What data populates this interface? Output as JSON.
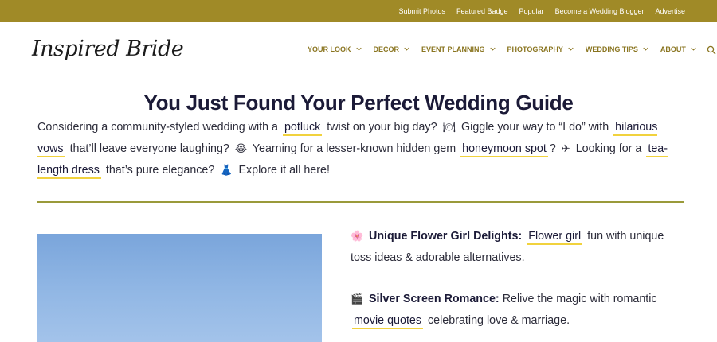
{
  "topbar": {
    "links": [
      "Submit Photos",
      "Featured Badge",
      "Popular",
      "Become a Wedding Blogger",
      "Advertise"
    ]
  },
  "logo": {
    "text": "Inspired Bride"
  },
  "nav": {
    "items": [
      "YOUR LOOK",
      "DECOR",
      "EVENT PLANNING",
      "PHOTOGRAPHY",
      "WEDDING TIPS",
      "ABOUT"
    ],
    "search_icon": "search-icon"
  },
  "page_title": "You Just Found Your Perfect Wedding Guide",
  "intro": {
    "t1": "Considering a community-styled wedding with a",
    "link1": "potluck",
    "t2": "twist on your big day?",
    "e1": "🍽",
    "t3": "Giggle your way to “I do” with",
    "link2": "hilarious vows",
    "t4": "that’ll leave everyone laughing?",
    "e2": "😂",
    "t5": "Yearning for a lesser-known hidden gem",
    "link3": "honeymoon spot",
    "t6": "?",
    "e3": "✈",
    "t7": "Looking for a",
    "link4": "tea-length dress",
    "t8": "that’s pure elegance?",
    "e4": "👗",
    "t9": "Explore it all here!"
  },
  "features": [
    {
      "icon": "🌸",
      "title": "Unique Flower Girl Delights:",
      "link": "Flower girl",
      "text": "fun with unique toss ideas & adorable alternatives."
    },
    {
      "icon": "🎬",
      "title": "Silver Screen Romance:",
      "pre": "Relive the magic with romantic",
      "link": "movie quotes",
      "text": "celebrating love & marriage."
    }
  ],
  "colors": {
    "topbar": "#a08a27",
    "nav": "#8a7520",
    "highlight": "#f1d23d",
    "title": "#1b1a37"
  }
}
